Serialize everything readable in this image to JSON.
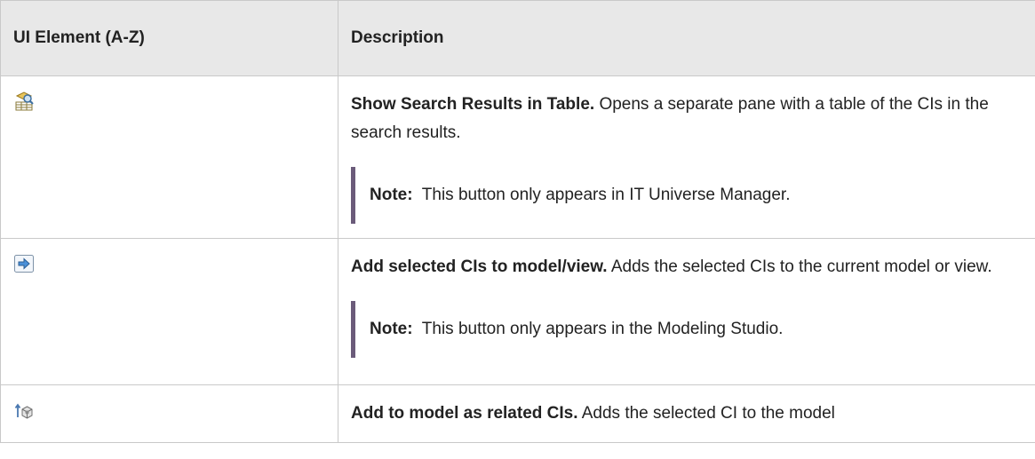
{
  "table": {
    "headers": [
      "UI Element (A-Z)",
      "Description"
    ],
    "rows": [
      {
        "icon": "search-results-table-icon",
        "title": "Show Search Results in Table.",
        "text": " Opens a separate pane with a table of the CIs in the search results.",
        "note_label": "Note:",
        "note_text": "  This button only appears in IT Universe Manager."
      },
      {
        "icon": "arrow-right-icon",
        "title": "Add selected CIs to model/view.",
        "text": " Adds the selected CIs to the current model or view.",
        "note_label": "Note:",
        "note_text": "  This button only appears in the Modeling Studio."
      },
      {
        "icon": "add-related-cis-icon",
        "title": "Add to model as related CIs.",
        "text": " Adds the selected CI to the model"
      }
    ]
  }
}
